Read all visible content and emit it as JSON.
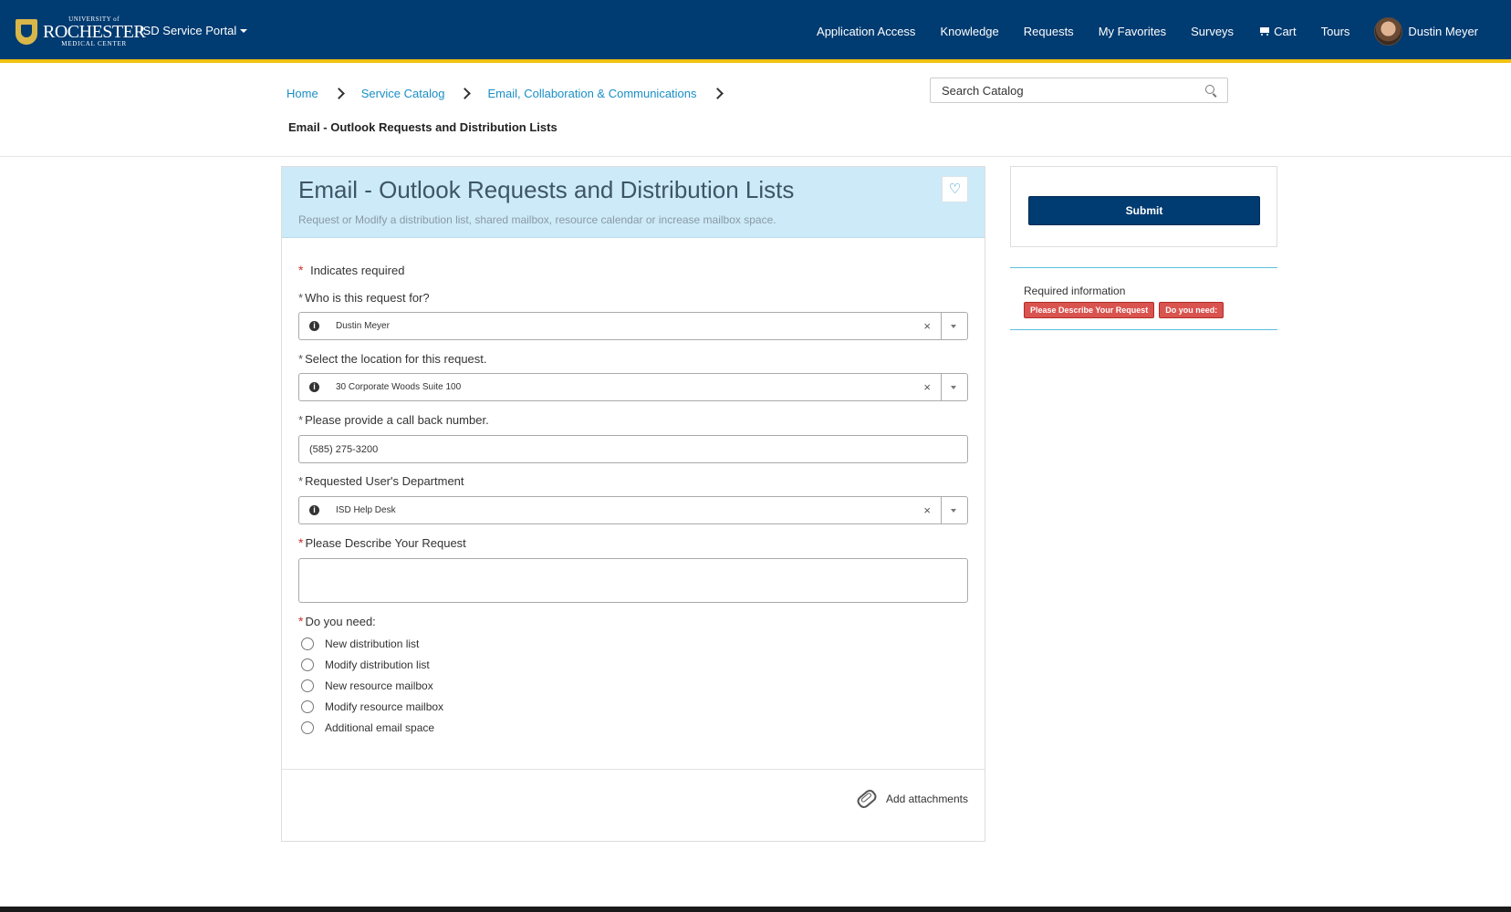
{
  "topbar": {
    "logo": {
      "line1": "UNIVERSITY of",
      "line2": "ROCHESTER",
      "line3": "MEDICAL CENTER"
    },
    "portal_name": "ISD Service Portal",
    "nav": [
      "Application Access",
      "Knowledge",
      "Requests",
      "My Favorites",
      "Surveys",
      "Cart",
      "Tours"
    ],
    "user_name": "Dustin Meyer"
  },
  "breadcrumbs": [
    "Home",
    "Service Catalog",
    "Email, Collaboration & Communications"
  ],
  "page_subtitle": "Email - Outlook Requests and Distribution Lists",
  "search": {
    "placeholder": "Search Catalog"
  },
  "form": {
    "title": "Email - Outlook Requests and Distribution Lists",
    "description": "Request or Modify a distribution list, shared mailbox, resource calendar or increase mailbox space.",
    "required_note": "Indicates required",
    "fields": {
      "requested_for": {
        "label": "Who is this request for?",
        "value": "Dustin Meyer"
      },
      "location": {
        "label": "Select the location for this request.",
        "value": "30 Corporate Woods Suite 100"
      },
      "callback": {
        "label": "Please provide a call back number.",
        "value": "(585) 275-3200"
      },
      "department": {
        "label": "Requested User's Department",
        "value": "ISD Help Desk"
      },
      "describe": {
        "label": "Please Describe Your Request",
        "value": ""
      },
      "do_you_need": {
        "label": "Do you need:",
        "options": [
          "New distribution list",
          "Modify distribution list",
          "New resource mailbox",
          "Modify resource mailbox",
          "Additional email space"
        ]
      }
    },
    "attachments_label": "Add attachments"
  },
  "side": {
    "submit_label": "Submit",
    "required_info_title": "Required information",
    "required_badges": [
      "Please Describe Your Request",
      "Do you need:"
    ]
  },
  "colors": {
    "brand": "#003b71",
    "accent": "#f2c20f",
    "link": "#1a8ec5",
    "error": "#d9534f"
  }
}
